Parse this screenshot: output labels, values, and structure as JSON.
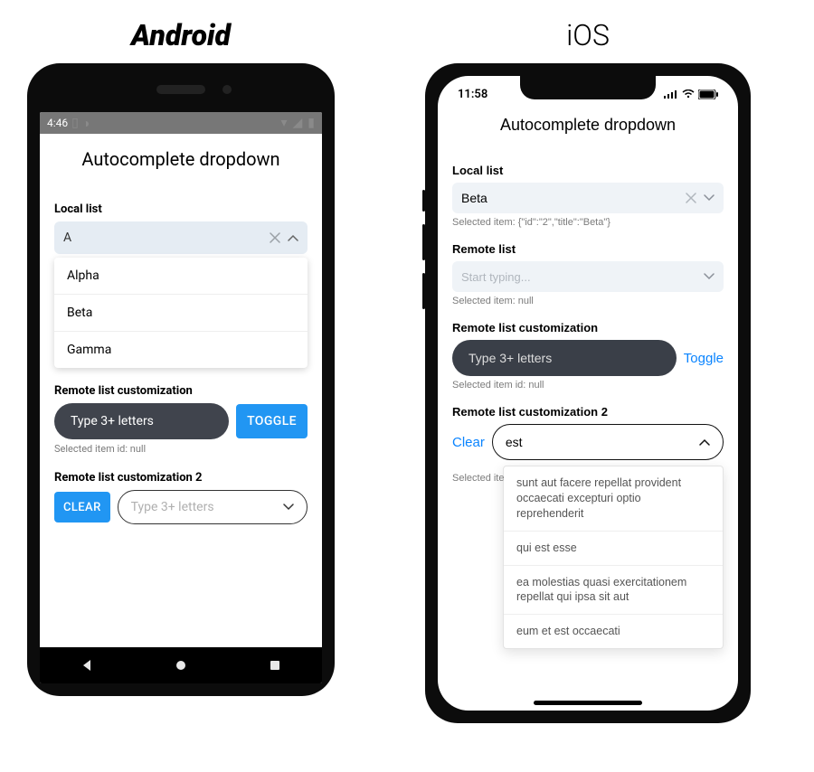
{
  "os_labels": {
    "android": "Android",
    "ios": "iOS"
  },
  "android": {
    "statusbar": {
      "time": "4:46"
    },
    "title": "Autocomplete dropdown",
    "local_list": {
      "label": "Local list",
      "value": "A",
      "options": {
        "0": "Alpha",
        "1": "Beta",
        "2": "Gamma"
      }
    },
    "remote_custom": {
      "label": "Remote list customization",
      "placeholder": "Type 3+ letters",
      "toggle_label": "TOGGLE",
      "selected_text": "Selected item id: null"
    },
    "remote_custom2": {
      "label": "Remote list customization 2",
      "clear_label": "CLEAR",
      "placeholder": "Type 3+ letters"
    }
  },
  "ios": {
    "statusbar": {
      "time": "11:58"
    },
    "title": "Autocomplete dropdown",
    "local_list": {
      "label": "Local list",
      "value": "Beta",
      "selected_text": "Selected item: {\"id\":\"2\",\"title\":\"Beta\"}"
    },
    "remote_list": {
      "label": "Remote list",
      "placeholder": "Start typing...",
      "selected_text": "Selected item: null"
    },
    "remote_custom": {
      "label": "Remote list customization",
      "placeholder": "Type 3+ letters",
      "toggle_label": "Toggle",
      "selected_text": "Selected item id: null"
    },
    "remote_custom2": {
      "label": "Remote list customization 2",
      "clear_label": "Clear",
      "value": "est",
      "selected_text_prefix": "Selected ite",
      "options": {
        "0": "sunt aut facere repellat provident occaecati excepturi optio reprehenderit",
        "1": "qui est esse",
        "2": "ea molestias quasi exercitationem repellat qui ipsa sit aut",
        "3": "eum et est occaecati"
      }
    }
  }
}
